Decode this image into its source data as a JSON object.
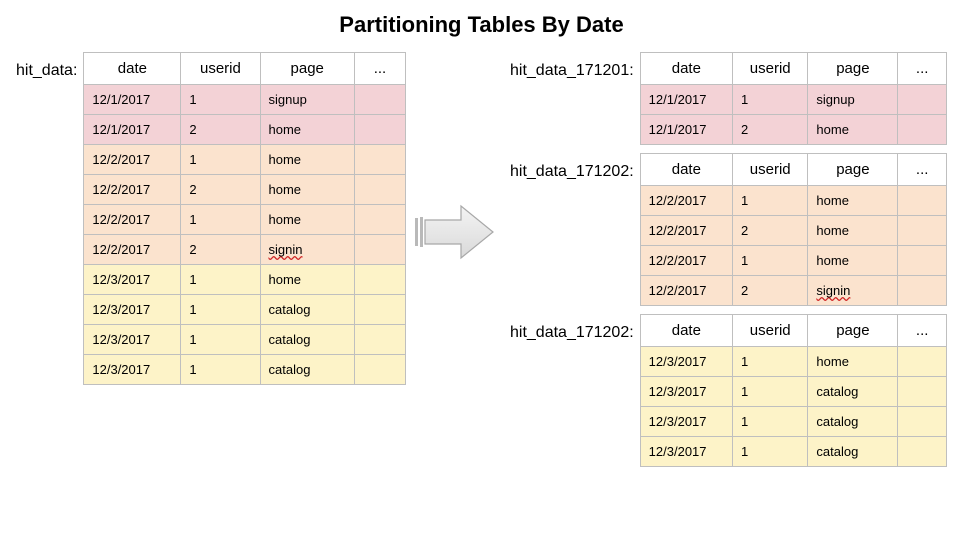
{
  "title": "Partitioning Tables By Date",
  "headers": {
    "date": "date",
    "userid": "userid",
    "page": "page",
    "ell": "..."
  },
  "left": {
    "label": "hit_data:",
    "rows": [
      {
        "g": 0,
        "date": "12/1/2017",
        "userid": "1",
        "page": "signup",
        "spell": false
      },
      {
        "g": 0,
        "date": "12/1/2017",
        "userid": "2",
        "page": "home",
        "spell": false
      },
      {
        "g": 1,
        "date": "12/2/2017",
        "userid": "1",
        "page": "home",
        "spell": false
      },
      {
        "g": 1,
        "date": "12/2/2017",
        "userid": "2",
        "page": "home",
        "spell": false
      },
      {
        "g": 1,
        "date": "12/2/2017",
        "userid": "1",
        "page": "home",
        "spell": false
      },
      {
        "g": 1,
        "date": "12/2/2017",
        "userid": "2",
        "page": "signin",
        "spell": true
      },
      {
        "g": 2,
        "date": "12/3/2017",
        "userid": "1",
        "page": "home",
        "spell": false
      },
      {
        "g": 2,
        "date": "12/3/2017",
        "userid": "1",
        "page": "catalog",
        "spell": false
      },
      {
        "g": 2,
        "date": "12/3/2017",
        "userid": "1",
        "page": "catalog",
        "spell": false
      },
      {
        "g": 2,
        "date": "12/3/2017",
        "userid": "1",
        "page": "catalog",
        "spell": false
      }
    ]
  },
  "right": [
    {
      "label": "hit_data_171201:",
      "rows": [
        {
          "g": 0,
          "date": "12/1/2017",
          "userid": "1",
          "page": "signup",
          "spell": false
        },
        {
          "g": 0,
          "date": "12/1/2017",
          "userid": "2",
          "page": "home",
          "spell": false
        }
      ]
    },
    {
      "label": "hit_data_171202:",
      "rows": [
        {
          "g": 1,
          "date": "12/2/2017",
          "userid": "1",
          "page": "home",
          "spell": false
        },
        {
          "g": 1,
          "date": "12/2/2017",
          "userid": "2",
          "page": "home",
          "spell": false
        },
        {
          "g": 1,
          "date": "12/2/2017",
          "userid": "1",
          "page": "home",
          "spell": false
        },
        {
          "g": 1,
          "date": "12/2/2017",
          "userid": "2",
          "page": "signin",
          "spell": true
        }
      ]
    },
    {
      "label": "hit_data_171202:",
      "rows": [
        {
          "g": 2,
          "date": "12/3/2017",
          "userid": "1",
          "page": "home",
          "spell": false
        },
        {
          "g": 2,
          "date": "12/3/2017",
          "userid": "1",
          "page": "catalog",
          "spell": false
        },
        {
          "g": 2,
          "date": "12/3/2017",
          "userid": "1",
          "page": "catalog",
          "spell": false
        },
        {
          "g": 2,
          "date": "12/3/2017",
          "userid": "1",
          "page": "catalog",
          "spell": false
        }
      ]
    }
  ]
}
